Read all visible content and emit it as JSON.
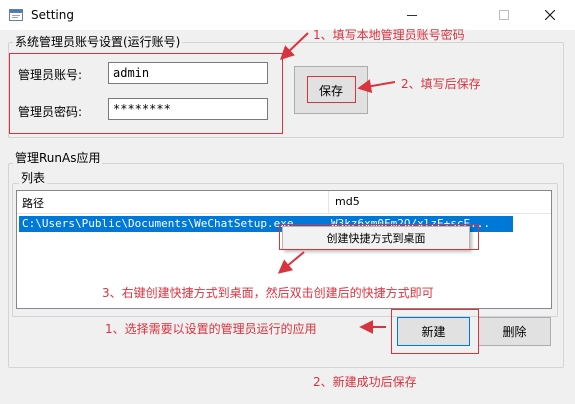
{
  "window": {
    "title": "Setting",
    "controls": {
      "minimize_icon": "minimize-icon",
      "maximize_icon": "maximize-icon",
      "close_icon": "close-icon"
    }
  },
  "admin_group": {
    "legend": "系统管理员账号设置(运行账号)",
    "account_label": "管理员账号:",
    "account_value": "admin",
    "password_label": "管理员密码:",
    "password_value": "********",
    "save_button": "保存"
  },
  "runas_group": {
    "legend": "管理RunAs应用",
    "list_legend": "列表",
    "columns": [
      "路径",
      "md5"
    ],
    "selected_row": {
      "path": "C:\\Users\\Public\\Documents\\WeChatSetup.exe",
      "md5": "W3kz6xm0Fm2Q/xlzE+scE..."
    },
    "context_menu_item": "创建快捷方式到桌面",
    "new_button": "新建",
    "delete_button": "删除"
  },
  "annotations": {
    "note1": "1、填写本地管理员账号密码",
    "note2": "2、填写后保存",
    "note3": "3、右键创建快捷方式到桌面，然后双击创建后的快捷方式即可",
    "note4": "1、选择需要以设置的管理员运行的应用",
    "note5": "2、新建成功后保存",
    "color": "#d9333f"
  },
  "colors": {
    "selection": "#0078d7",
    "focus_border": "#0078d7",
    "window_bg": "#f0f0f0"
  }
}
